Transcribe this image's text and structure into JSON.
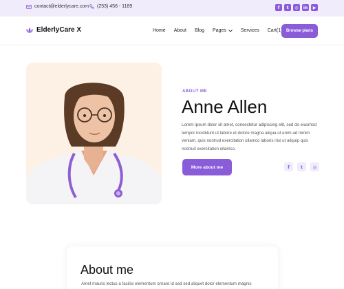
{
  "topbar": {
    "email": "contact@elderlycare.com",
    "phone": "(253) 456 - 1189",
    "socials": [
      "facebook-icon",
      "twitter-icon",
      "instagram-icon",
      "linkedin-icon",
      "youtube-icon"
    ]
  },
  "header": {
    "brand": "ElderlyCare X",
    "nav": [
      "Home",
      "About",
      "Blog",
      "Pages",
      "Services",
      "Cart(1)"
    ],
    "cta": "Browse plans"
  },
  "hero": {
    "eyebrow": "ABOUT ME",
    "name": "Anne Allen",
    "bio": "Lorem ipsum dolor sit amet, consectetur adipiscing elit, sed do eiusmod tempor incididunt ut labore et dolore magna aliqua ut enim ad minim veniam, quis nostrud exercitation ullamco laboris nisi ut aliquip quis nostrud exercitation ullamco.",
    "button": "More about me",
    "socials": [
      "facebook-icon",
      "twitter-icon",
      "instagram-icon"
    ]
  },
  "about": {
    "title": "About me",
    "text": "Amet mauris lectus a facilisi elementum ornare id sed sed aliquet dolor elementum magnis"
  },
  "colors": {
    "accent": "#8a5cd8",
    "topbar_bg": "#f0ecfb",
    "photo_bg": "#fdf0e4"
  }
}
